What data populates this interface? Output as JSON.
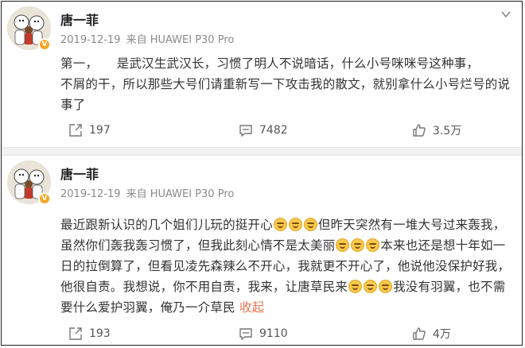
{
  "posts": [
    {
      "username": "唐一菲",
      "date": "2019-12-19",
      "source": "来自 HUAWEI P30 Pro",
      "content_lines": [
        "第一，　　是武汉生武汉长，习惯了明人不说暗话，什么小号咪咪号这种事，",
        "不屑的干，所以那些大号们请重新写一下攻击我的散文，就别拿什么小号烂号的说",
        "事了"
      ],
      "repost_count": "197",
      "comment_count": "7482",
      "like_count": "3.5万"
    },
    {
      "username": "唐一菲",
      "date": "2019-12-19",
      "source": "来自 HUAWEI P30 Pro",
      "content_segments": {
        "l1a": "最近跟新认识的几个姐们儿玩的挺开心",
        "l1b": "但昨天突然有一堆大号过来轰我，",
        "l2a": "虽然你们轰我轰习惯了，但我此刻心情不是太美丽",
        "l2b": "本来也还是想十年如一",
        "l3": "日的拉倒算了，但看见凌先森辣么不开心，我就更不开心了，他说他没保护好我，",
        "l4a": "他很自责。我想说，你不用自责，我来，让唐草民来",
        "l4b": "我没有羽翼，也不需",
        "l5": "要什么爱护羽翼，俺乃一介草民",
        "collapse": "收起"
      },
      "repost_count": "193",
      "comment_count": "9110",
      "like_count": "4万"
    }
  ],
  "icons": {
    "repost": "repost-icon",
    "comment": "comment-icon",
    "like": "thumbs-up-icon",
    "menu": "chevron-down-icon",
    "verified": "verified-badge-icon",
    "emoji": "grin-emoji-icon"
  },
  "colors": {
    "link": "#eb7350",
    "verified": "#f5a623",
    "meta": "#8a8a8a"
  }
}
